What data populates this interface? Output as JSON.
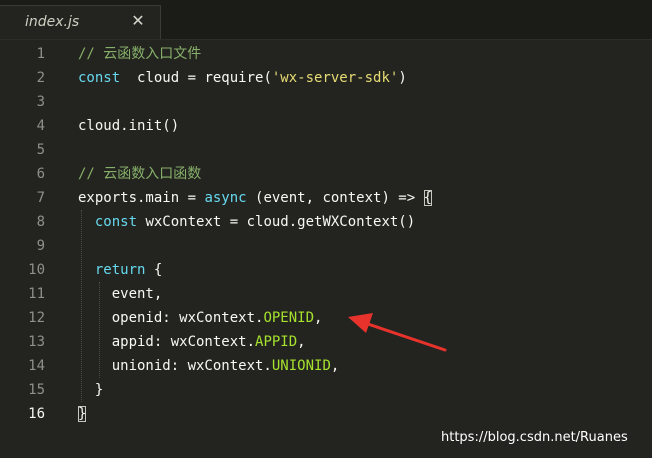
{
  "tab": {
    "title": "index.js",
    "close_glyph": "✕"
  },
  "lines": [
    {
      "n": "1",
      "parts": [
        [
          "cm-zh",
          "// 云函数入口文件"
        ]
      ]
    },
    {
      "n": "2",
      "parts": [
        [
          "kw",
          "const"
        ],
        [
          "",
          "  cloud = require("
        ],
        [
          "str",
          "'wx-server-sdk'"
        ],
        [
          "",
          ")"
        ]
      ]
    },
    {
      "n": "3",
      "parts": []
    },
    {
      "n": "4",
      "parts": [
        [
          "",
          "cloud.init()"
        ]
      ]
    },
    {
      "n": "5",
      "parts": []
    },
    {
      "n": "6",
      "parts": [
        [
          "cm-zh",
          "// 云函数入口函数"
        ]
      ]
    },
    {
      "n": "7",
      "parts": [
        [
          "",
          "exports.main = "
        ],
        [
          "kw",
          "async"
        ],
        [
          "",
          " (event, context) => "
        ],
        [
          "brace",
          "{"
        ]
      ]
    },
    {
      "n": "8",
      "parts": [
        [
          "",
          "  "
        ],
        [
          "kw",
          "const"
        ],
        [
          "",
          " wxContext = cloud.getWXContext()"
        ]
      ]
    },
    {
      "n": "9",
      "parts": []
    },
    {
      "n": "10",
      "parts": [
        [
          "",
          "  "
        ],
        [
          "kw",
          "return"
        ],
        [
          "",
          " {"
        ]
      ]
    },
    {
      "n": "11",
      "parts": [
        [
          "",
          "    event,"
        ]
      ]
    },
    {
      "n": "12",
      "parts": [
        [
          "",
          "    openid: wxContext."
        ],
        [
          "prop",
          "OPENID"
        ],
        [
          "",
          ","
        ]
      ]
    },
    {
      "n": "13",
      "parts": [
        [
          "",
          "    appid: wxContext."
        ],
        [
          "prop",
          "APPID"
        ],
        [
          "",
          ","
        ]
      ]
    },
    {
      "n": "14",
      "parts": [
        [
          "",
          "    unionid: wxContext."
        ],
        [
          "prop",
          "UNIONID"
        ],
        [
          "",
          ","
        ]
      ]
    },
    {
      "n": "15",
      "parts": [
        [
          "",
          "  }"
        ]
      ]
    },
    {
      "n": "16",
      "parts": [
        [
          "brace",
          "}"
        ]
      ],
      "active": true
    }
  ],
  "watermark": "https://blog.csdn.net/Ruanes",
  "colors": {
    "background": "#23241f",
    "keyword": "#66d9ef",
    "string": "#e6db74",
    "comment": "#87b06a",
    "property": "#a6e22e",
    "arrow": "#e8322c"
  }
}
